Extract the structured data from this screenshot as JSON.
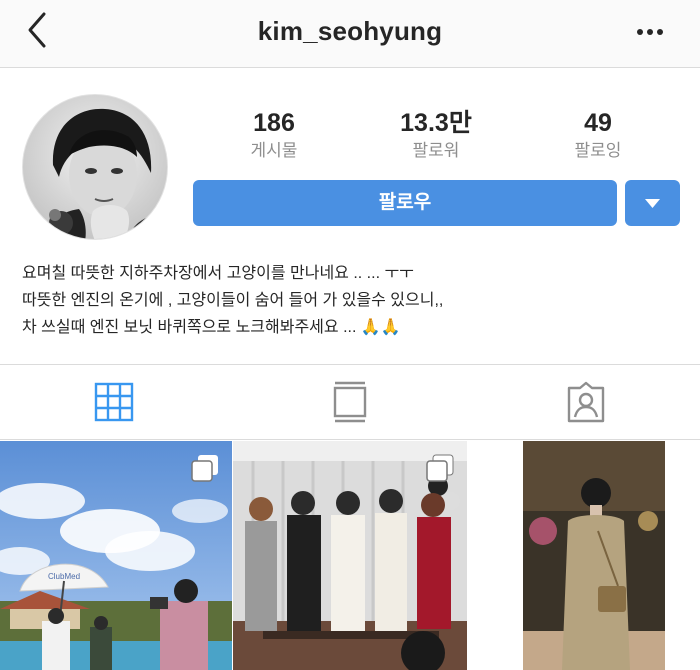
{
  "header": {
    "username": "kim_seohyung",
    "back_icon": "chevron-left-icon",
    "more_icon": "more-horizontal-icon"
  },
  "profile": {
    "stats": [
      {
        "value": "186",
        "label": "게시물"
      },
      {
        "value": "13.3만",
        "label": "팔로워"
      },
      {
        "value": "49",
        "label": "팔로잉"
      }
    ],
    "follow_label": "팔로우",
    "bio_lines": [
      "요며칠 따뜻한 지하주차장에서 고양이를 만나네요 .. ... ㅜㅜ",
      "따뜻한 엔진의 온기에 , 고양이들이 숨어 들어 가 있을수 있으니,,",
      "차 쓰실때 엔진 보닛 바퀴쪽으로 노크해봐주세요 ... 🙏🙏"
    ]
  },
  "tabs": [
    {
      "icon": "grid-icon",
      "active": true
    },
    {
      "icon": "feed-icon",
      "active": false
    },
    {
      "icon": "tagged-user-icon",
      "active": false
    }
  ],
  "grid_posts": [
    {
      "type": "photo",
      "multi": true,
      "umbrella_text": "ClubMed"
    },
    {
      "type": "photo",
      "multi": true
    },
    {
      "type": "photo",
      "multi": false
    }
  ],
  "colors": {
    "accent": "#4a90e2",
    "active_tab": "#3897f0",
    "inactive_icon": "#8e8e8e",
    "text": "#262626",
    "secondary_text": "#8e8e8e"
  }
}
